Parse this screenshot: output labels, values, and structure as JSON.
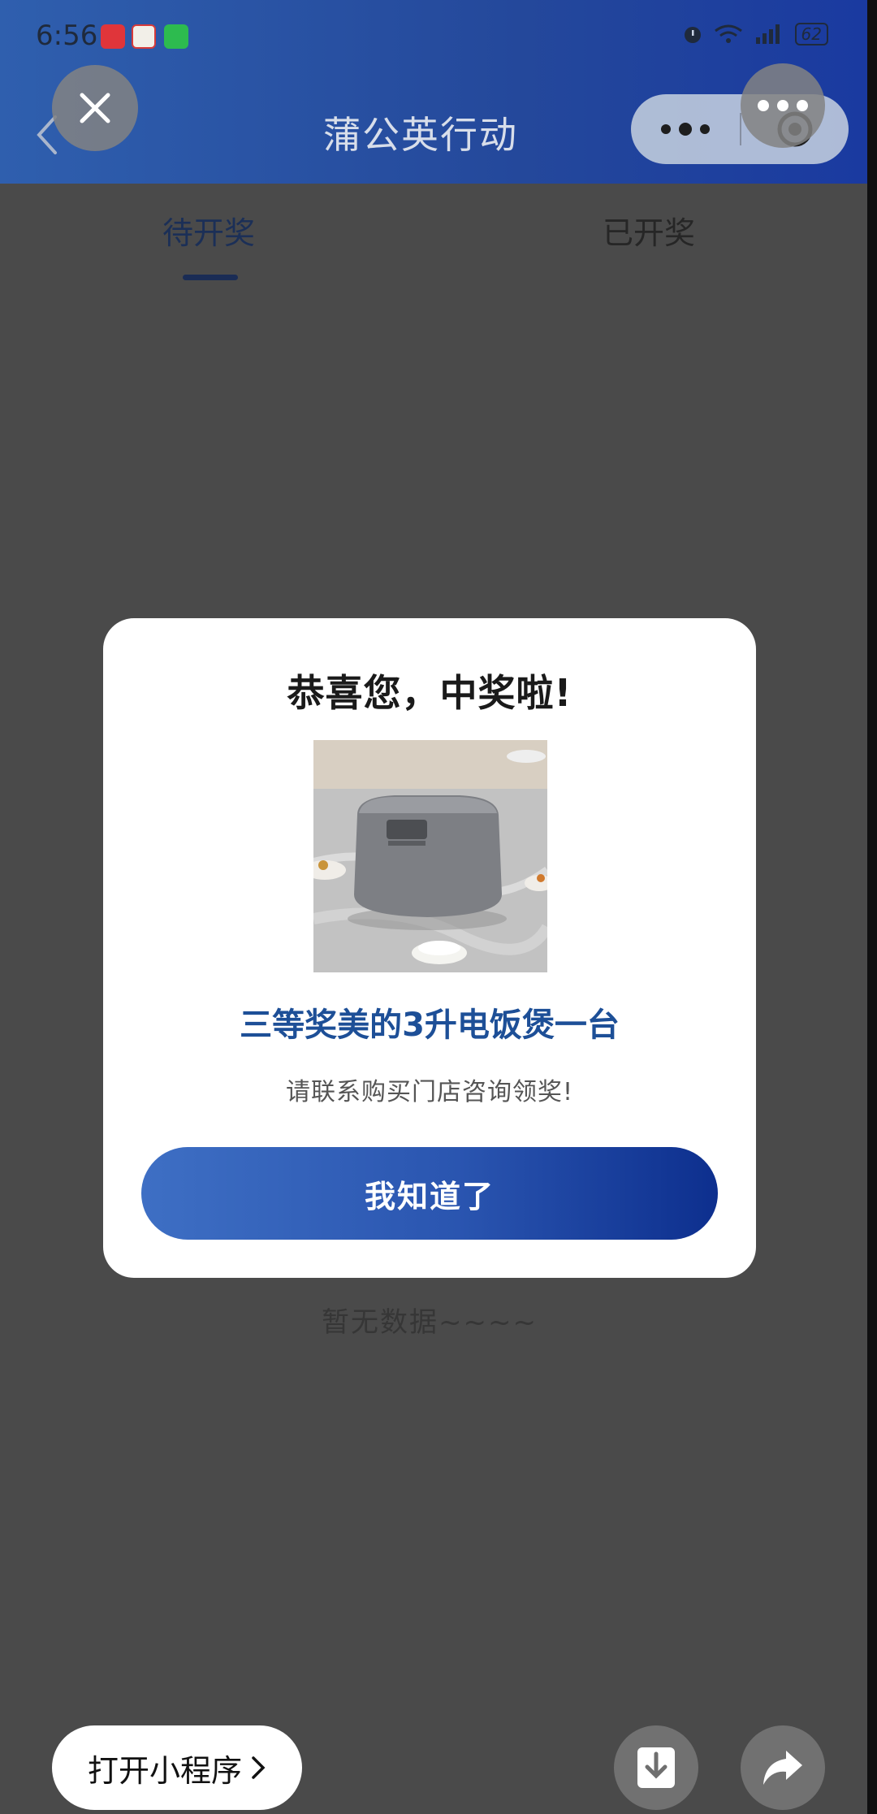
{
  "status_bar": {
    "time": "6:56",
    "battery": "62"
  },
  "nav": {
    "title": "蒲公英行动"
  },
  "tabs": [
    {
      "label": "待开奖",
      "active": true
    },
    {
      "label": "已开奖",
      "active": false
    }
  ],
  "main": {
    "empty_text": "暂无数据~~~~"
  },
  "modal": {
    "title": "恭喜您，中奖啦!",
    "prize_name": "三等奖美的3升电饭煲一台",
    "hint": "请联系购买门店咨询领奖!",
    "confirm_label": "我知道了"
  },
  "bottom_bar": {
    "open_mini_label": "打开小程序"
  },
  "colors": {
    "header_gradient_start": "#2f5fae",
    "header_gradient_end": "#1a3aa0",
    "accent": "#1d4f97",
    "button_gradient_start": "#3e6fc4",
    "button_gradient_end": "#0d2f8e"
  },
  "icons": {
    "close": "close-icon",
    "back": "back-arrow-icon",
    "more": "more-dots-icon",
    "target": "target-icon",
    "download": "download-icon",
    "share": "share-arrow-icon"
  }
}
